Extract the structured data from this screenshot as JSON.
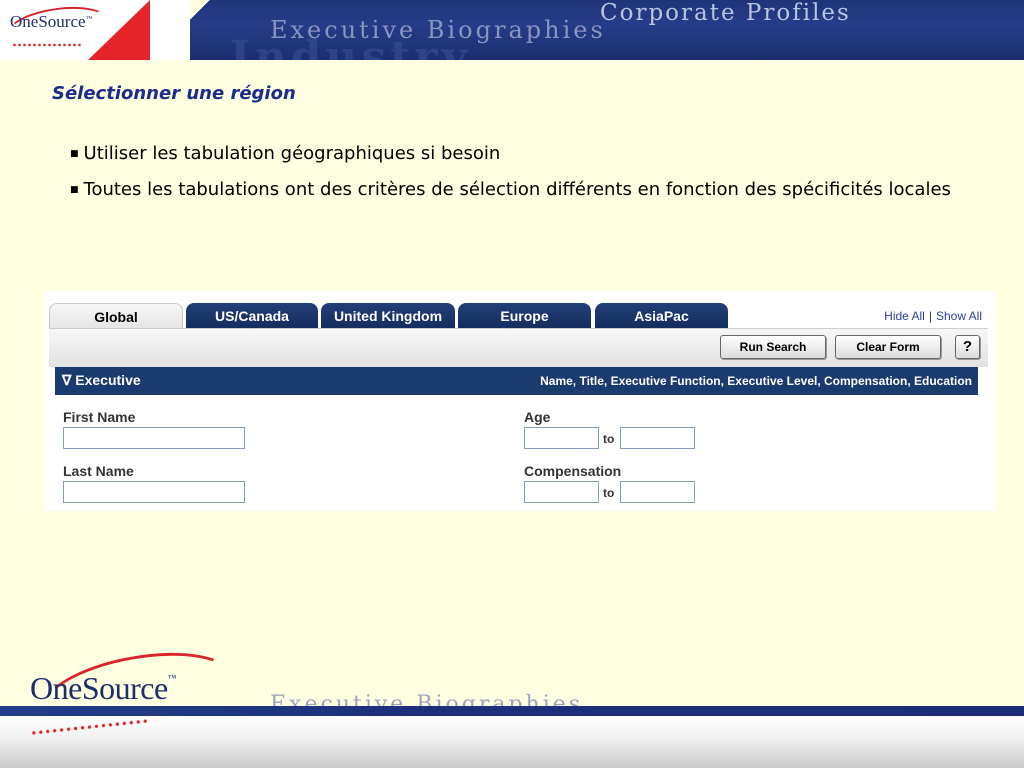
{
  "banner": {
    "logo_text": "OneSource",
    "logo_tm": "™",
    "line1": "Corporate Profiles",
    "line2": "Executive Biographies",
    "line3": "Industry"
  },
  "slide": {
    "title": "Sélectionner une région",
    "bullets": [
      "Utiliser les tabulation géographiques si besoin",
      "Toutes les tabulations ont des critères de sélection différents en fonction des spécificités locales"
    ]
  },
  "app": {
    "tabs": [
      {
        "label": "Global",
        "active": true
      },
      {
        "label": "US/Canada",
        "active": false
      },
      {
        "label": "United Kingdom",
        "active": false
      },
      {
        "label": "Europe",
        "active": false
      },
      {
        "label": "AsiaPac",
        "active": false
      }
    ],
    "hide_all": "Hide All",
    "separator": "|",
    "show_all": "Show All",
    "buttons": {
      "run_search": "Run Search",
      "clear_form": "Clear Form",
      "help": "?"
    },
    "section": {
      "toggle_icon": "∇",
      "title": "Executive",
      "subtitle": "Name, Title, Executive Function, Executive Level, Compensation, Education"
    },
    "fields": {
      "first_name_label": "First Name",
      "last_name_label": "Last Name",
      "age_label": "Age",
      "compensation_label": "Compensation",
      "to_label": "to"
    }
  },
  "footer": {
    "logo_text": "OneSource",
    "logo_tm": "™",
    "band_text": "Executive Biographies"
  },
  "colors": {
    "background": "#fefee0",
    "title_blue": "#1b2c8c",
    "tab_blue": "#1b3a6d",
    "brand_red": "#d9242a"
  }
}
